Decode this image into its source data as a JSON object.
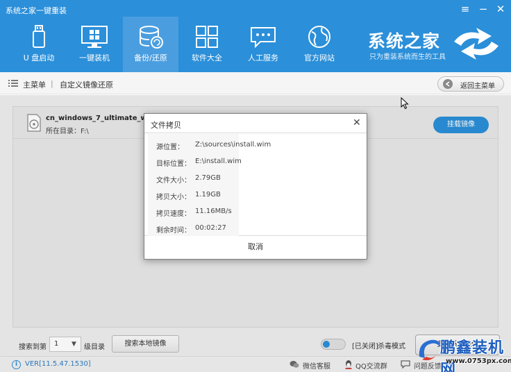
{
  "app": {
    "title": "系统之家一键重装"
  },
  "window_controls": [
    "menu-icon",
    "minimize-icon",
    "close-icon"
  ],
  "nav": [
    {
      "label": "U 盘启动",
      "icon": "usb-drive-icon",
      "active": false
    },
    {
      "label": "一键装机",
      "icon": "windows-monitor-icon",
      "active": false
    },
    {
      "label": "备份/还原",
      "icon": "database-restore-icon",
      "active": true
    },
    {
      "label": "软件大全",
      "icon": "app-grid-icon",
      "active": false
    },
    {
      "label": "人工服务",
      "icon": "chat-bubble-icon",
      "active": false
    },
    {
      "label": "官方网站",
      "icon": "globe-icon",
      "active": false
    }
  ],
  "brand": {
    "logo_text": "系统之家",
    "slogan": "只为重装系统而生的工具"
  },
  "breadcrumb": {
    "main": "主菜单",
    "separator": "|",
    "current": "自定义镜像还原",
    "back_label": "返回主菜单"
  },
  "file_list": [
    {
      "name": "cn_windows_7_ultimate_with_sp1_x64_dvd",
      "dir": "所在目录：F:\\",
      "action": "挂载镜像"
    }
  ],
  "bottom": {
    "search_to": "搜索到第",
    "level_value": "1",
    "level_label": "级目录",
    "search_local": "搜索本地镜像",
    "antivirus_state": "[已关闭]",
    "antivirus_label": "杀毒模式",
    "install": "安装系统镜像"
  },
  "status": {
    "version": "VER[11.5.47.1530]",
    "wechat": "微信客服",
    "qq": "QQ交流群",
    "feedback": "问题反馈"
  },
  "dialog": {
    "title": "文件拷贝",
    "close": "✕",
    "rows": [
      {
        "label": "源位置：",
        "value": "Z:\\sources\\install.wim"
      },
      {
        "label": "目标位置：",
        "value": "E:\\install.wim"
      },
      {
        "label": "文件大小：",
        "value": "2.79GB"
      },
      {
        "label": "拷贝大小：",
        "value": "1.19GB"
      },
      {
        "label": "拷贝速度：",
        "value": "11.16MB/s"
      },
      {
        "label": "剩余时间：",
        "value": "00:02:27"
      }
    ],
    "cancel": "取消"
  },
  "watermark": {
    "name": "鹏鑫装机网",
    "url": "www.0753px.com"
  },
  "colors": {
    "header_blue": "#2b8fd9",
    "active_tab": "#4a9ee0",
    "link_blue": "#2b7cc4"
  }
}
